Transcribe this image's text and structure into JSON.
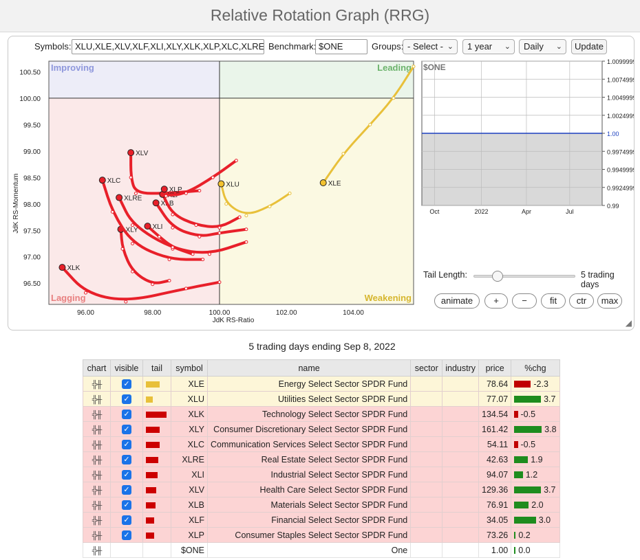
{
  "title": "Relative Rotation Graph (RRG)",
  "controls": {
    "symbols_label": "Symbols:",
    "symbols_value": "XLU,XLE,XLV,XLF,XLI,XLY,XLK,XLP,XLC,XLRE,XLB",
    "benchmark_label": "Benchmark:",
    "benchmark_value": "$ONE",
    "groups_label": "Groups:",
    "groups_selected": "- Select -",
    "period_selected": "1 year",
    "frequency_selected": "Daily",
    "update_label": "Update"
  },
  "tail": {
    "label": "Tail Length:",
    "value_text": "5 trading days",
    "slider_fraction": 0.04,
    "buttons": [
      "animate",
      "+",
      "−",
      "fit",
      "ctr",
      "max"
    ]
  },
  "caption": "5 trading days ending Sep 8, 2022",
  "chart_data": {
    "type": "scatter",
    "xlabel": "JdK RS-Ratio",
    "ylabel": "JdK RS-Momentum",
    "xlim": [
      94.9,
      105.8
    ],
    "ylim": [
      96.1,
      100.7
    ],
    "xticks": [
      "96.00",
      "98.00",
      "100.00",
      "102.00",
      "104.00"
    ],
    "yticks": [
      "96.50",
      "97.00",
      "97.50",
      "98.00",
      "98.50",
      "99.00",
      "99.50",
      "100.00",
      "100.50"
    ],
    "quadrants": [
      "Improving",
      "Leading",
      "Weakening",
      "Lagging"
    ],
    "colors": {
      "leading": "#e8c03a",
      "lagging": "#e8202a",
      "improving_bg": "#ededf8",
      "leading_bg": "#eaf5ea",
      "weakening_bg": "#fbf9e2",
      "lagging_bg": "#fbe9e9"
    },
    "series": [
      {
        "name": "XLE",
        "color": "#e8c03a",
        "x": [
          105.8,
          105.2,
          104.5,
          103.7,
          103.1
        ],
        "y": [
          100.6,
          100.0,
          99.5,
          98.95,
          98.4
        ]
      },
      {
        "name": "XLU",
        "color": "#e8c03a",
        "x": [
          102.1,
          101.5,
          100.8,
          100.2,
          100.05
        ],
        "y": [
          98.2,
          97.95,
          97.78,
          98.0,
          98.38
        ]
      },
      {
        "name": "XLK",
        "color": "#e8202a",
        "x": [
          100.0,
          99.0,
          97.2,
          96.0,
          95.3
        ],
        "y": [
          96.52,
          96.4,
          96.15,
          96.32,
          96.8
        ]
      },
      {
        "name": "XLY",
        "color": "#e8202a",
        "x": [
          98.5,
          98.0,
          97.4,
          97.1,
          97.05
        ],
        "y": [
          96.55,
          96.48,
          96.72,
          97.15,
          97.52
        ]
      },
      {
        "name": "XLC",
        "color": "#e8202a",
        "x": [
          99.5,
          98.5,
          97.4,
          96.8,
          96.5
        ],
        "y": [
          96.95,
          96.95,
          97.25,
          97.85,
          98.45
        ]
      },
      {
        "name": "XLRE",
        "color": "#e8202a",
        "x": [
          100.8,
          99.7,
          98.6,
          97.4,
          97.0
        ],
        "y": [
          97.28,
          97.05,
          97.15,
          97.6,
          98.12
        ]
      },
      {
        "name": "XLI",
        "color": "#e8202a",
        "x": [
          99.2,
          98.6,
          98.2,
          97.85
        ],
        "y": [
          97.05,
          97.18,
          97.38,
          97.58
        ]
      },
      {
        "name": "XLV",
        "color": "#e8202a",
        "x": [
          99.4,
          98.4,
          97.5,
          97.35,
          97.35
        ],
        "y": [
          98.25,
          98.2,
          98.2,
          98.5,
          98.97
        ]
      },
      {
        "name": "XLB",
        "color": "#e8202a",
        "x": [
          100.8,
          100.0,
          99.4,
          98.6,
          98.1
        ],
        "y": [
          97.52,
          97.45,
          97.38,
          97.55,
          98.02
        ]
      },
      {
        "name": "XLF",
        "color": "#e8202a",
        "x": [
          100.6,
          100.0,
          99.3,
          98.6,
          98.3
        ],
        "y": [
          97.75,
          97.55,
          97.6,
          97.8,
          98.18
        ]
      },
      {
        "name": "XLP",
        "color": "#e8202a",
        "x": [
          100.5,
          99.8,
          99.0,
          98.4,
          98.35
        ],
        "y": [
          98.82,
          98.5,
          98.2,
          98.15,
          98.28
        ]
      }
    ]
  },
  "mini_chart": {
    "title": "$ONE",
    "y_ticks": [
      "1.0099999",
      "1.0074999",
      "1.0049999",
      "1.0024999",
      "1.00",
      "0.9974999",
      "0.9949999",
      "0.9924999",
      "0.99"
    ],
    "x_ticks": [
      "Oct",
      "2022",
      "Apr",
      "Jul"
    ],
    "value": 1.0
  },
  "table": {
    "headers": [
      "chart",
      "visible",
      "tail",
      "symbol",
      "name",
      "sector",
      "industry",
      "price",
      "%chg"
    ],
    "rows": [
      {
        "cls": "yel",
        "tail_color": "#e8c03a",
        "tail_w": 20,
        "symbol": "XLE",
        "name": "Energy Select Sector SPDR Fund",
        "price": "78.64",
        "chg": "-2.3",
        "chg_val": -2.3,
        "visible": true
      },
      {
        "cls": "yel",
        "tail_color": "#e8c03a",
        "tail_w": 10,
        "symbol": "XLU",
        "name": "Utilities Select Sector SPDR Fund",
        "price": "77.07",
        "chg": "3.7",
        "chg_val": 3.7,
        "visible": true
      },
      {
        "cls": "red",
        "tail_color": "#cc0000",
        "tail_w": 30,
        "symbol": "XLK",
        "name": "Technology Select Sector SPDR Fund",
        "price": "134.54",
        "chg": "-0.5",
        "chg_val": -0.5,
        "visible": true
      },
      {
        "cls": "red",
        "tail_color": "#cc0000",
        "tail_w": 20,
        "symbol": "XLY",
        "name": "Consumer Discretionary Select Sector SPDR Fund",
        "price": "161.42",
        "chg": "3.8",
        "chg_val": 3.8,
        "visible": true
      },
      {
        "cls": "red",
        "tail_color": "#cc0000",
        "tail_w": 20,
        "symbol": "XLC",
        "name": "Communication Services Select Sector SPDR Fund",
        "price": "54.11",
        "chg": "-0.5",
        "chg_val": -0.5,
        "visible": true
      },
      {
        "cls": "red",
        "tail_color": "#cc0000",
        "tail_w": 18,
        "symbol": "XLRE",
        "name": "Real Estate Select Sector SPDR Fund",
        "price": "42.63",
        "chg": "1.9",
        "chg_val": 1.9,
        "visible": true
      },
      {
        "cls": "red",
        "tail_color": "#cc0000",
        "tail_w": 17,
        "symbol": "XLI",
        "name": "Industrial Select Sector SPDR Fund",
        "price": "94.07",
        "chg": "1.2",
        "chg_val": 1.2,
        "visible": true
      },
      {
        "cls": "red",
        "tail_color": "#cc0000",
        "tail_w": 15,
        "symbol": "XLV",
        "name": "Health Care Select Sector SPDR Fund",
        "price": "129.36",
        "chg": "3.7",
        "chg_val": 3.7,
        "visible": true
      },
      {
        "cls": "red",
        "tail_color": "#cc0000",
        "tail_w": 14,
        "symbol": "XLB",
        "name": "Materials Select Sector SPDR Fund",
        "price": "76.91",
        "chg": "2.0",
        "chg_val": 2.0,
        "visible": true
      },
      {
        "cls": "red",
        "tail_color": "#cc0000",
        "tail_w": 12,
        "symbol": "XLF",
        "name": "Financial Select Sector SPDR Fund",
        "price": "34.05",
        "chg": "3.0",
        "chg_val": 3.0,
        "visible": true
      },
      {
        "cls": "red",
        "tail_color": "#cc0000",
        "tail_w": 12,
        "symbol": "XLP",
        "name": "Consumer Staples Select Sector SPDR Fund",
        "price": "73.26",
        "chg": "0.2",
        "chg_val": 0.2,
        "visible": true
      },
      {
        "cls": "plain",
        "tail_color": "",
        "tail_w": 0,
        "symbol": "$ONE",
        "name": "One",
        "price": "1.00",
        "chg": "0.0",
        "chg_val": 0.0,
        "visible": false
      }
    ]
  }
}
